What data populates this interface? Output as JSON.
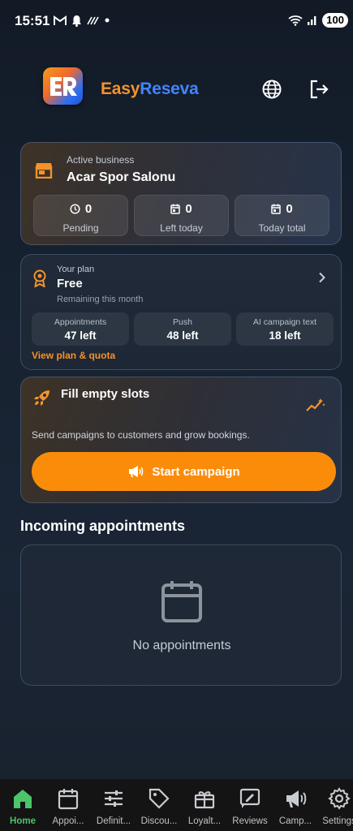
{
  "status_bar": {
    "time": "15:51",
    "battery": "100",
    "icons_left": [
      "gmail-icon",
      "bell-icon",
      "wifi-calling-icon",
      "dot-icon"
    ],
    "icons_right": [
      "wifi-icon",
      "signal-icon",
      "battery-icon"
    ]
  },
  "header": {
    "logo_text": "ER",
    "app_name_part1": "Easy",
    "app_name_part2": "Reseva",
    "language_icon": "globe-icon",
    "logout_icon": "logout-icon"
  },
  "business": {
    "label": "Active business",
    "name": "Acar Spor Salonu",
    "stats": [
      {
        "value": "0",
        "label": "Pending",
        "icon": "clock-icon"
      },
      {
        "value": "0",
        "label": "Left today",
        "icon": "calendar-icon"
      },
      {
        "value": "0",
        "label": "Today total",
        "icon": "calendar-icon"
      }
    ]
  },
  "plan": {
    "label": "Your plan",
    "name": "Free",
    "remaining": "Remaining this month",
    "quotas": [
      {
        "label": "Appointments",
        "value": "47 left"
      },
      {
        "label": "Push",
        "value": "48 left"
      },
      {
        "label": "AI campaign text",
        "value": "18 left"
      }
    ],
    "link": "View plan & quota"
  },
  "campaign": {
    "title": "Fill empty slots",
    "description": "Send campaigns to customers and grow bookings.",
    "button": "Start campaign"
  },
  "incoming": {
    "title": "Incoming appointments",
    "empty_text": "No appointments"
  },
  "nav": [
    {
      "label": "Home",
      "icon": "home-icon",
      "active": true
    },
    {
      "label": "Appoi...",
      "icon": "calendar-icon"
    },
    {
      "label": "Definit...",
      "icon": "sliders-icon"
    },
    {
      "label": "Discou...",
      "icon": "tag-icon"
    },
    {
      "label": "Loyalt...",
      "icon": "gift-icon"
    },
    {
      "label": "Reviews",
      "icon": "review-icon"
    },
    {
      "label": "Camp...",
      "icon": "megaphone-icon"
    },
    {
      "label": "Settings",
      "icon": "gear-icon"
    }
  ],
  "colors": {
    "accent_orange": "#fb8c0a",
    "brand_blue": "#3f86ff",
    "nav_active": "#4cc46a"
  }
}
